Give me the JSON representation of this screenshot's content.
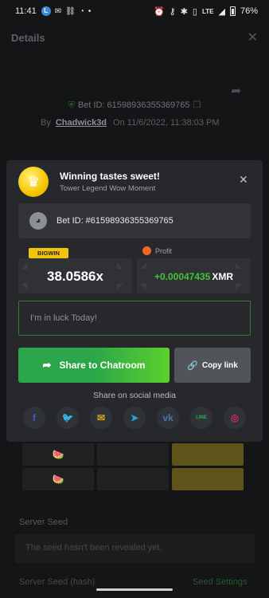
{
  "status_bar": {
    "time": "11:41",
    "network": "LTE",
    "battery": "76%"
  },
  "background": {
    "title": "Details",
    "bet_id": "Bet ID: 61598936355369765",
    "by_label": "By",
    "username": "Chadwick3d",
    "on_label": "On",
    "date": "11/6/2022, 11:38:03 PM",
    "server_seed_label": "Server Seed",
    "server_seed_value": "The seed hasn't been revealed yet.",
    "server_seed_hash_label": "Server Seed (hash)",
    "seed_settings_link": "Seed Settings"
  },
  "share_card": {
    "title": "Winning tastes sweet!",
    "subtitle": "Tower Legend Wow Moment",
    "bet_id": "Bet ID: #61598936355369765",
    "badge": "BIGWIN",
    "multiplier": "38.0586x",
    "profit_label": "Profit",
    "profit_amount": "+0.00047435",
    "profit_currency": "XMR",
    "message_placeholder": "I'm in luck Today!",
    "share_button": "Share to Chatroom",
    "copy_button": "Copy link",
    "social_label": "Share on social media",
    "socials": [
      {
        "name": "facebook",
        "glyph": "f",
        "color": "#3b5bdb"
      },
      {
        "name": "twitter",
        "glyph": "🐦",
        "color": "#1d9bf0"
      },
      {
        "name": "email",
        "glyph": "✉",
        "color": "#d4a017"
      },
      {
        "name": "telegram",
        "glyph": "➤",
        "color": "#2aa3e0"
      },
      {
        "name": "vk",
        "glyph": "vk",
        "color": "#4a76a8"
      },
      {
        "name": "line",
        "glyph": "LINE",
        "color": "#2bb24c"
      },
      {
        "name": "instagram",
        "glyph": "◎",
        "color": "#d6246e"
      }
    ]
  },
  "colors": {
    "accent_green": "#2ba64a",
    "profit_green": "#3fc43b",
    "badge_gold": "#f1c40f"
  }
}
